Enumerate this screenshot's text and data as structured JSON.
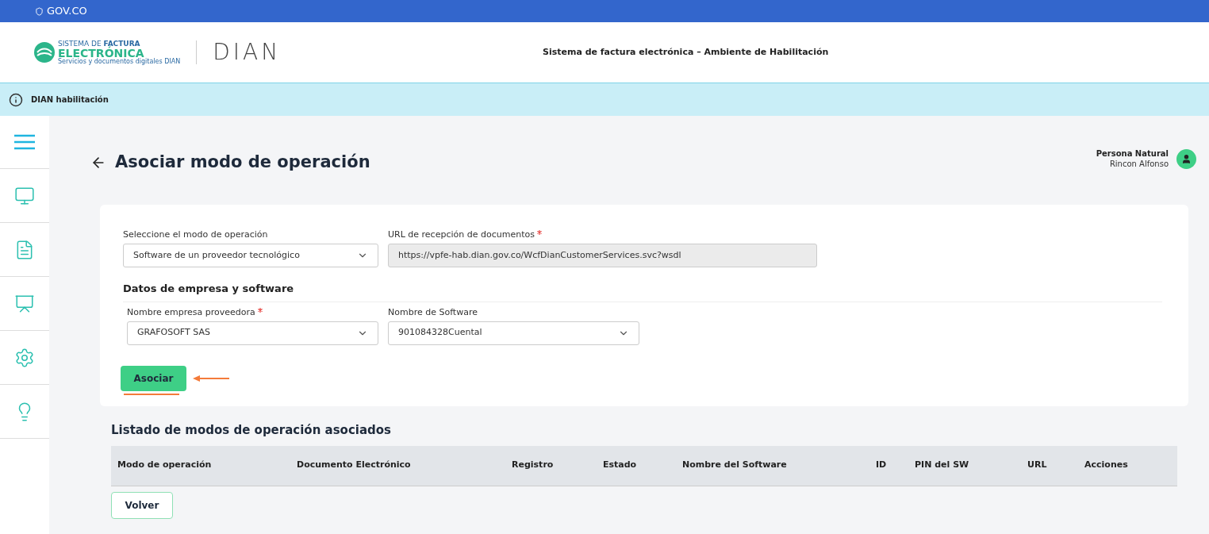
{
  "top_bar": {
    "brand": "GOV.CO"
  },
  "header": {
    "logo": {
      "line1": "SISTEMA DE **FACTURA**",
      "line2": "ELECTRÓNICA",
      "line3": "Servicios y documentos digitales DIAN",
      "partner": "DIAN"
    },
    "title": "Sistema de factura electrónica – Ambiente de Habilitación"
  },
  "info_bar": {
    "text": "DIAN habilitación"
  },
  "page": {
    "title": "Asociar modo de operación",
    "user": {
      "role": "Persona Natural",
      "name": "Rincon Alfonso"
    }
  },
  "form": {
    "mode": {
      "label": "Seleccione el modo de operación",
      "required": false,
      "value": "Software de un proveedor tecnológico"
    },
    "url": {
      "label": "URL de recepción de documentos",
      "required": true,
      "value": "https://vpfe-hab.dian.gov.co/WcfDianCustomerServices.svc?wsdl"
    },
    "section_title": "Datos de empresa y software",
    "company": {
      "label": "Nombre empresa proveedora",
      "required": true,
      "value": "GRAFOSOFT SAS"
    },
    "software": {
      "label": "Nombre de Software",
      "required": false,
      "value": "901084328Cuental"
    },
    "submit": "Asociar"
  },
  "list": {
    "title": "Listado de modos de operación asociados",
    "columns": [
      "Modo de operación",
      "Documento Electrónico",
      "Registro",
      "Estado",
      "Nombre del Software",
      "ID",
      "PIN del SW",
      "URL",
      "Acciones"
    ]
  },
  "back_button": "Volver"
}
